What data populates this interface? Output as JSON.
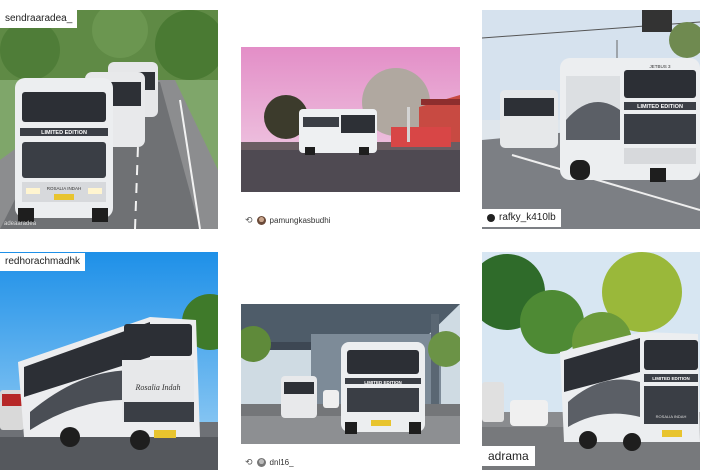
{
  "posts": [
    {
      "username": "sendraaradea_",
      "watermark": "adeaaradea"
    },
    {
      "caption_user": "pamungkasbudhi"
    },
    {
      "username": "rafky_k410lb"
    },
    {
      "username": "redhorachmadhk"
    },
    {
      "caption_user": "dnl16_"
    },
    {
      "username": "adrama"
    }
  ],
  "bus_text": {
    "limited_edition": "LIMITED EDITION",
    "rosalia_indah": "ROSALIA INDAH",
    "jetbus": "JETBUS 3"
  },
  "colors": {
    "bus_body": "#e9ebee",
    "bus_stripe": "#3b3f46",
    "sky": "#b9d8ec",
    "road": "#5d6065",
    "foliage": "#5a8a3a"
  }
}
